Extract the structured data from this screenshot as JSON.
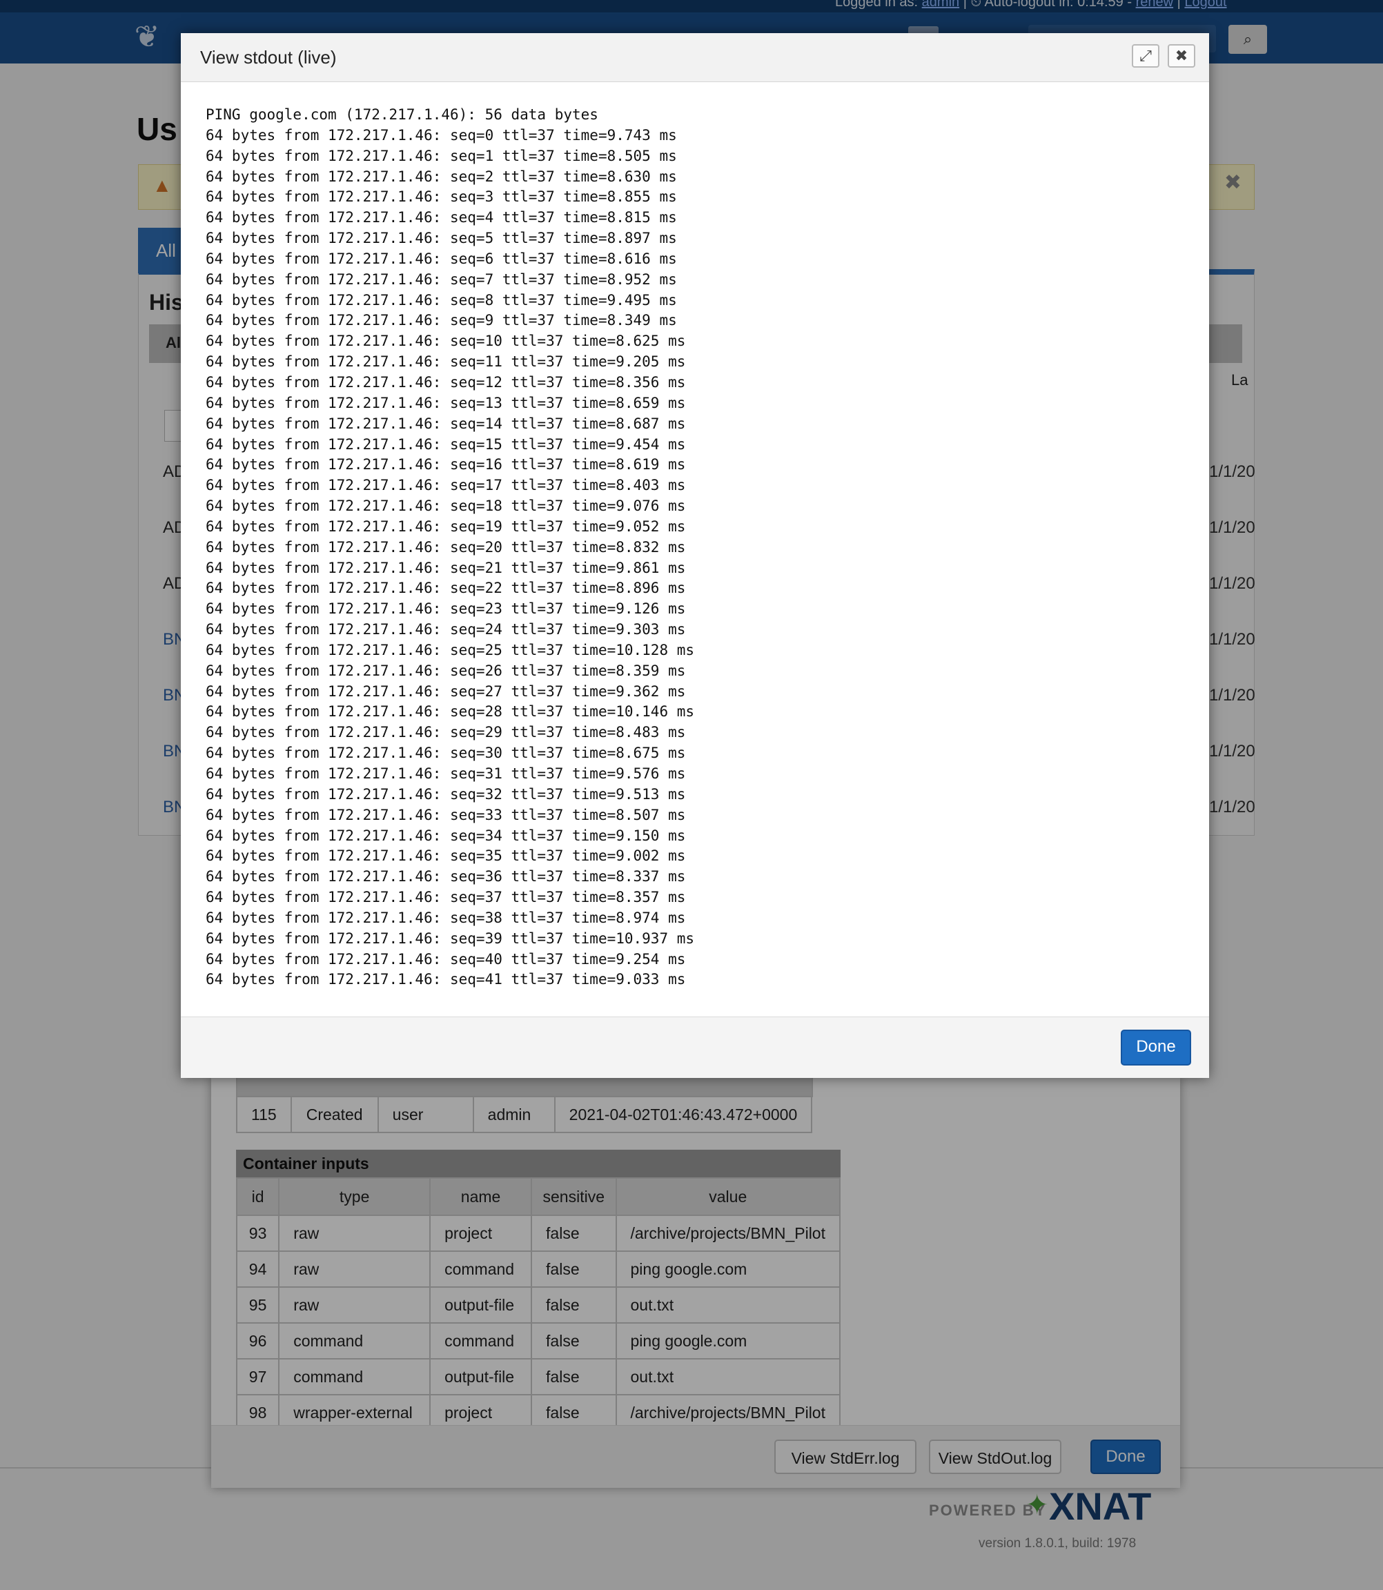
{
  "topbar": {
    "logged_in_label": "Logged in as:",
    "user": "admin",
    "autologout_label": "Auto-logout in:",
    "autologout_time": "0:14:59",
    "renew": "renew",
    "logout": "Logout"
  },
  "background": {
    "page_title": "Us",
    "tab_all": "All",
    "history_heading": "His",
    "header_stub": "Al",
    "col_stub": "La",
    "rows": [
      {
        "label": "AD",
        "date": "1/1/20"
      },
      {
        "label": "AD",
        "date": "1/1/20"
      },
      {
        "label": "AD",
        "date": "1/1/20"
      },
      {
        "label": "BN",
        "date": "1/1/20"
      },
      {
        "label": "BN",
        "date": "1/1/20"
      },
      {
        "label": "BN",
        "date": "1/1/20"
      },
      {
        "label": "BN",
        "date": "1/1/20"
      }
    ]
  },
  "history_row": {
    "id": "115",
    "status": "Created",
    "entity_type": "user",
    "entity_id": "admin",
    "time": "2021-04-02T01:46:43.472+0000"
  },
  "container_inputs": {
    "title": "Container inputs",
    "columns": [
      "id",
      "type",
      "name",
      "sensitive",
      "value"
    ],
    "rows": [
      {
        "id": "93",
        "type": "raw",
        "name": "project",
        "sensitive": "false",
        "value": "/archive/projects/BMN_Pilot"
      },
      {
        "id": "94",
        "type": "raw",
        "name": "command",
        "sensitive": "false",
        "value": "ping google.com"
      },
      {
        "id": "95",
        "type": "raw",
        "name": "output-file",
        "sensitive": "false",
        "value": "out.txt"
      },
      {
        "id": "96",
        "type": "command",
        "name": "command",
        "sensitive": "false",
        "value": "ping google.com"
      },
      {
        "id": "97",
        "type": "command",
        "name": "output-file",
        "sensitive": "false",
        "value": "out.txt"
      },
      {
        "id": "98",
        "type": "wrapper-external",
        "name": "project",
        "sensitive": "false",
        "value": "/archive/projects/BMN_Pilot"
      }
    ]
  },
  "details_footer": {
    "stderr_label": "View StdErr.log",
    "stdout_label": "View StdOut.log",
    "done_label": "Done"
  },
  "footer": {
    "powered_by": "POWERED BY",
    "brand": "XNAT",
    "version": "version 1.8.0.1, build: 1978"
  },
  "modal": {
    "title": "View stdout (live)",
    "expand_icon": "expand-icon",
    "close_icon": "close-icon",
    "done_label": "Done",
    "lines": [
      "PING google.com (172.217.1.46): 56 data bytes",
      "64 bytes from 172.217.1.46: seq=0 ttl=37 time=9.743 ms",
      "64 bytes from 172.217.1.46: seq=1 ttl=37 time=8.505 ms",
      "64 bytes from 172.217.1.46: seq=2 ttl=37 time=8.630 ms",
      "64 bytes from 172.217.1.46: seq=3 ttl=37 time=8.855 ms",
      "64 bytes from 172.217.1.46: seq=4 ttl=37 time=8.815 ms",
      "64 bytes from 172.217.1.46: seq=5 ttl=37 time=8.897 ms",
      "64 bytes from 172.217.1.46: seq=6 ttl=37 time=8.616 ms",
      "64 bytes from 172.217.1.46: seq=7 ttl=37 time=8.952 ms",
      "64 bytes from 172.217.1.46: seq=8 ttl=37 time=9.495 ms",
      "64 bytes from 172.217.1.46: seq=9 ttl=37 time=8.349 ms",
      "64 bytes from 172.217.1.46: seq=10 ttl=37 time=8.625 ms",
      "64 bytes from 172.217.1.46: seq=11 ttl=37 time=9.205 ms",
      "64 bytes from 172.217.1.46: seq=12 ttl=37 time=8.356 ms",
      "64 bytes from 172.217.1.46: seq=13 ttl=37 time=8.659 ms",
      "64 bytes from 172.217.1.46: seq=14 ttl=37 time=8.687 ms",
      "64 bytes from 172.217.1.46: seq=15 ttl=37 time=9.454 ms",
      "64 bytes from 172.217.1.46: seq=16 ttl=37 time=8.619 ms",
      "64 bytes from 172.217.1.46: seq=17 ttl=37 time=8.403 ms",
      "64 bytes from 172.217.1.46: seq=18 ttl=37 time=9.076 ms",
      "64 bytes from 172.217.1.46: seq=19 ttl=37 time=9.052 ms",
      "64 bytes from 172.217.1.46: seq=20 ttl=37 time=8.832 ms",
      "64 bytes from 172.217.1.46: seq=21 ttl=37 time=9.861 ms",
      "64 bytes from 172.217.1.46: seq=22 ttl=37 time=8.896 ms",
      "64 bytes from 172.217.1.46: seq=23 ttl=37 time=9.126 ms",
      "64 bytes from 172.217.1.46: seq=24 ttl=37 time=9.303 ms",
      "64 bytes from 172.217.1.46: seq=25 ttl=37 time=10.128 ms",
      "64 bytes from 172.217.1.46: seq=26 ttl=37 time=8.359 ms",
      "64 bytes from 172.217.1.46: seq=27 ttl=37 time=9.362 ms",
      "64 bytes from 172.217.1.46: seq=28 ttl=37 time=10.146 ms",
      "64 bytes from 172.217.1.46: seq=29 ttl=37 time=8.483 ms",
      "64 bytes from 172.217.1.46: seq=30 ttl=37 time=8.675 ms",
      "64 bytes from 172.217.1.46: seq=31 ttl=37 time=9.576 ms",
      "64 bytes from 172.217.1.46: seq=32 ttl=37 time=9.513 ms",
      "64 bytes from 172.217.1.46: seq=33 ttl=37 time=8.507 ms",
      "64 bytes from 172.217.1.46: seq=34 ttl=37 time=9.150 ms",
      "64 bytes from 172.217.1.46: seq=35 ttl=37 time=9.002 ms",
      "64 bytes from 172.217.1.46: seq=36 ttl=37 time=8.337 ms",
      "64 bytes from 172.217.1.46: seq=37 ttl=37 time=8.357 ms",
      "64 bytes from 172.217.1.46: seq=38 ttl=37 time=8.974 ms",
      "64 bytes from 172.217.1.46: seq=39 ttl=37 time=10.937 ms",
      "64 bytes from 172.217.1.46: seq=40 ttl=37 time=9.254 ms",
      "64 bytes from 172.217.1.46: seq=41 ttl=37 time=9.033 ms"
    ]
  }
}
